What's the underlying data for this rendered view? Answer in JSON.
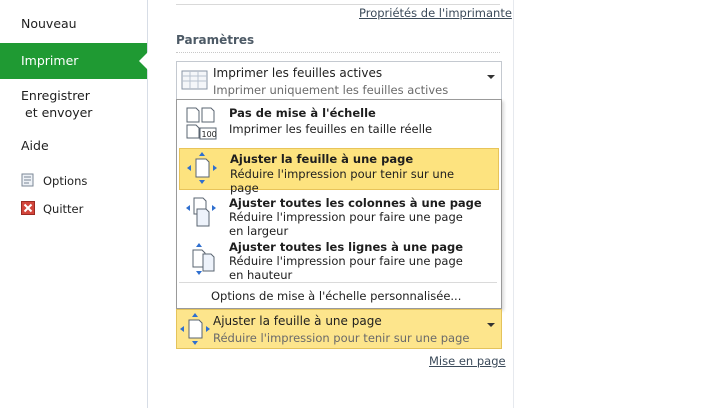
{
  "nav": {
    "items": [
      {
        "label": "Nouveau"
      },
      {
        "label": "Imprimer"
      },
      {
        "label": "Enregistrer"
      },
      {
        "label": "et envoyer"
      },
      {
        "label": "Aide"
      },
      {
        "label": "Options"
      },
      {
        "label": "Quitter"
      }
    ]
  },
  "links": {
    "printer_properties": "Propriétés de l'imprimante",
    "page_setup": "Mise en page"
  },
  "settings": {
    "title": "Paramètres",
    "print_what": {
      "main": "Imprimer les feuilles actives",
      "sub": "Imprimer uniquement les feuilles actives"
    },
    "scaling": {
      "main": "Ajuster la feuille à une page",
      "sub": "Réduire l'impression pour tenir sur une page"
    }
  },
  "menu": {
    "items": [
      {
        "title": "Pas de mise à l'échelle",
        "desc": "Imprimer les feuilles en taille réelle",
        "icon": "no-scaling-icon",
        "badge": "100"
      },
      {
        "title": "Ajuster la feuille à une page",
        "desc": "Réduire l'impression pour tenir sur une page",
        "icon": "fit-sheet-icon"
      },
      {
        "title": "Ajuster toutes les colonnes à une page",
        "desc": "Réduire l'impression pour faire une page en largeur",
        "icon": "fit-columns-icon"
      },
      {
        "title": "Ajuster toutes les lignes à une page",
        "desc": "Réduire l'impression pour faire une page en hauteur",
        "icon": "fit-rows-icon"
      }
    ],
    "footer": "Options de mise à l'échelle personnalisée..."
  },
  "colors": {
    "nav_active": "#1f9a33",
    "highlight": "#fde37f",
    "highlight_border": "#e8c45a"
  }
}
